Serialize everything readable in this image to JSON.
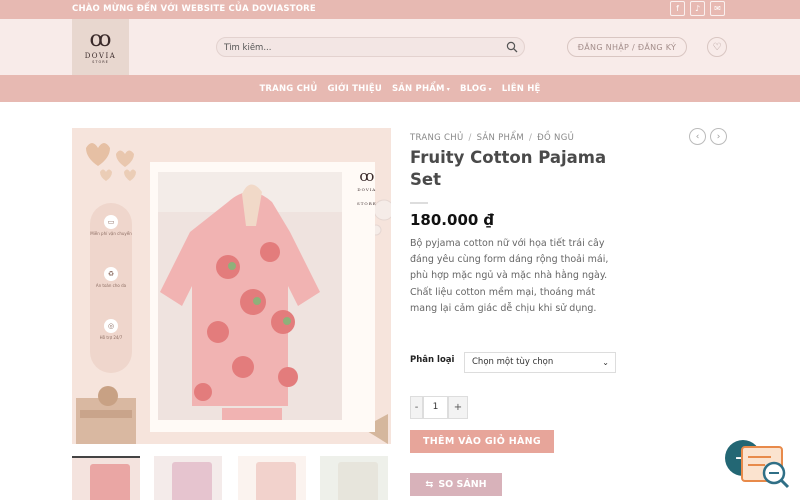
{
  "topbar": {
    "welcome": "CHÀO MỪNG ĐẾN VỚI WEBSITE CỦA DOVIASTORE",
    "social": [
      "f",
      "♪",
      "✉"
    ]
  },
  "header": {
    "logo_brand": "DOVIA",
    "logo_sub": "STORE",
    "search_placeholder": "Tìm kiếm...",
    "login_label": "ĐĂNG NHẬP / ĐĂNG KÝ"
  },
  "nav": {
    "items": [
      {
        "label": "TRANG CHỦ"
      },
      {
        "label": "GIỚI THIỆU"
      },
      {
        "label": "SẢN PHẨM"
      },
      {
        "label": "BLOG"
      },
      {
        "label": "LIÊN HỆ"
      }
    ]
  },
  "gallery": {
    "frame_logo": "DOVIA",
    "frame_logo_sub": "STORE",
    "features": [
      {
        "label": "Miễn phí vận chuyển"
      },
      {
        "label": "An toàn cho da"
      },
      {
        "label": "Hỗ trợ 24/7"
      }
    ]
  },
  "product": {
    "breadcrumb": [
      "TRANG CHỦ",
      "SẢN PHẨM",
      "ĐỒ NGỦ"
    ],
    "title": "Fruity Cotton Pajama Set",
    "price": "180.000 ₫",
    "description": "Bộ pyjama cotton nữ với họa tiết trái cây đáng yêu cùng form dáng rộng thoải mái, phù hợp mặc ngủ và mặc nhà hằng ngày. Chất liệu cotton mềm mại, thoáng mát mang lại cảm giác dễ chịu khi sử dụng.",
    "variant_label": "Phân loại",
    "variant_selected": "Chọn một tùy chọn",
    "quantity": "1",
    "qty_minus": "-",
    "qty_plus": "+",
    "add_to_cart": "THÊM VÀO GIỎ HÀNG",
    "compare": "SO SÁNH"
  },
  "colors": {
    "accent": "#e7b9b2",
    "button": "#e7a59a",
    "compare_button": "#d8b2ba",
    "float_button": "#236774"
  }
}
